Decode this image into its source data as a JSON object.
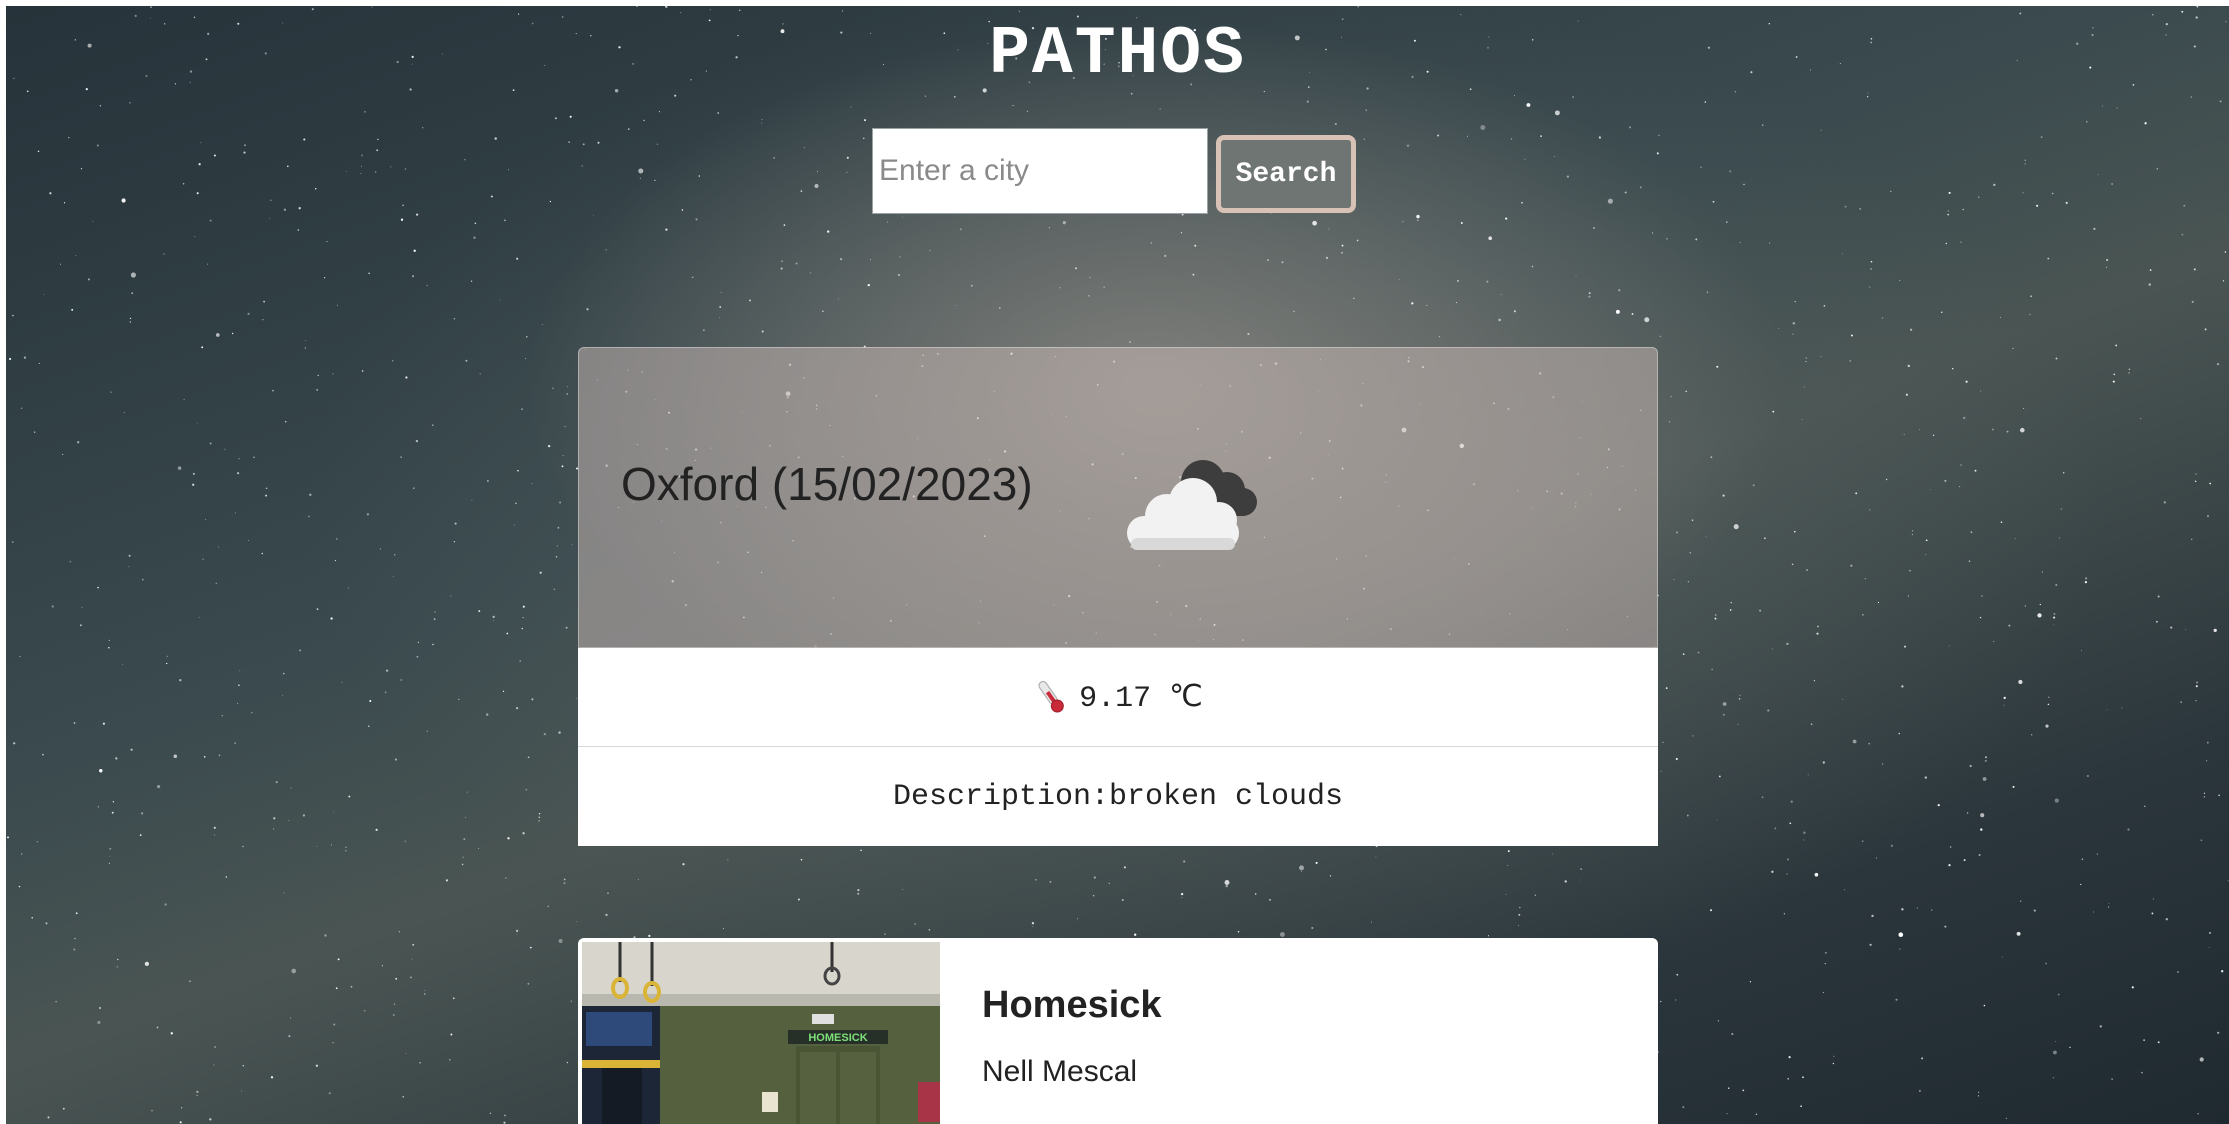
{
  "app": {
    "title": "PATHOS"
  },
  "search": {
    "placeholder": "Enter a city",
    "value": "",
    "button_label": "Search"
  },
  "weather": {
    "city_date": "Oxford (15/02/2023)",
    "icon": "broken-clouds-icon",
    "temperature": "9.17 ℃",
    "description": "Description:broken clouds"
  },
  "song": {
    "title": "Homesick",
    "artist": "Nell Mescal",
    "image_sign_text": "HOMESICK"
  },
  "colors": {
    "search_button_bg": "#6f7573",
    "search_button_border": "#d8c2b6",
    "title_color": "#ffffff"
  }
}
